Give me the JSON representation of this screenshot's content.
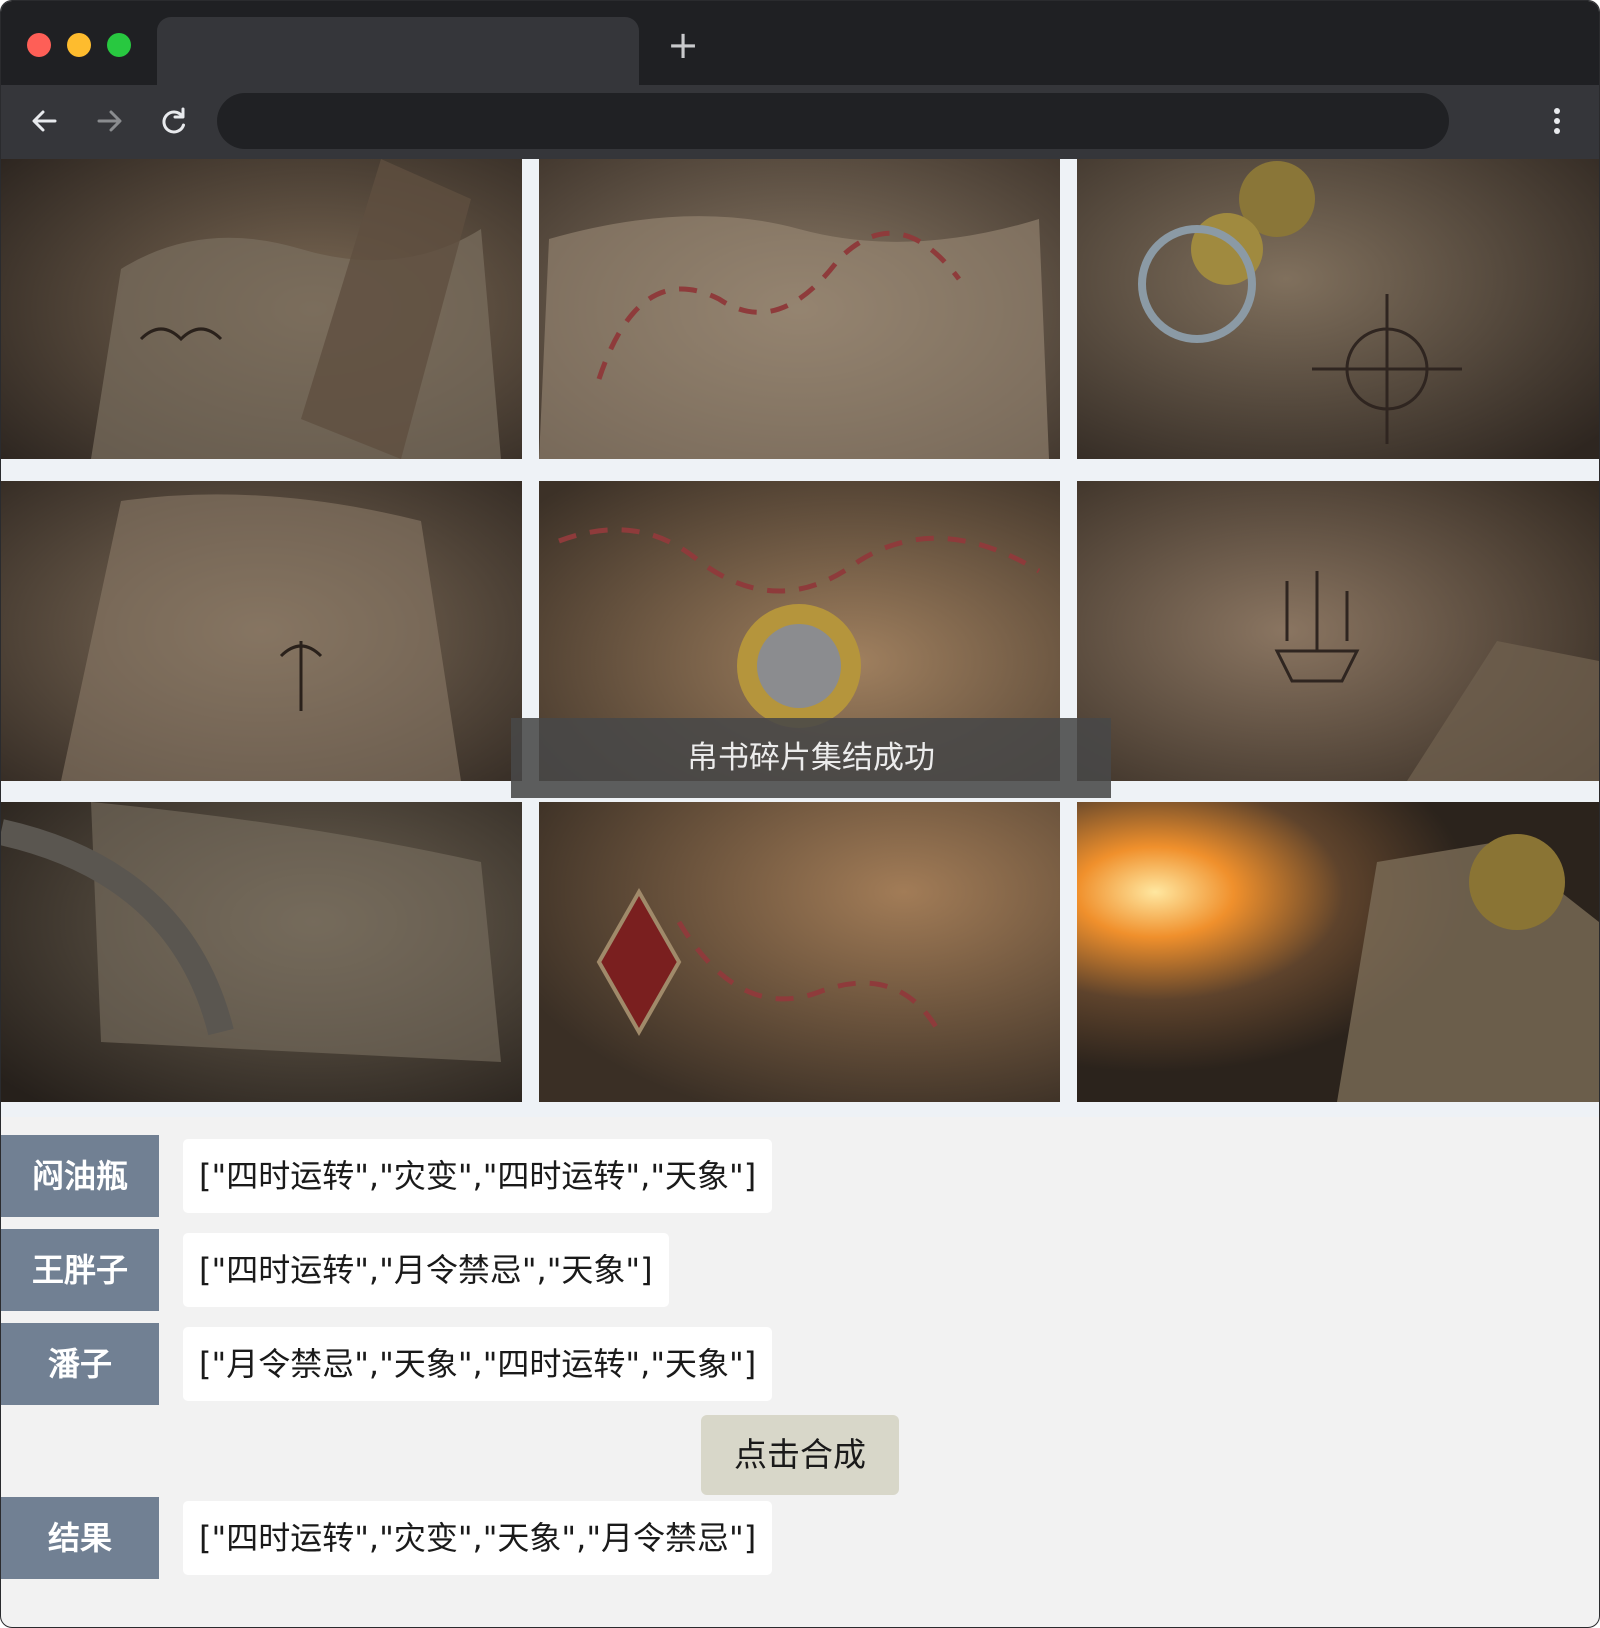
{
  "browser": {
    "new_tab_symbol": "+",
    "icons": [
      "back-arrow-icon",
      "forward-arrow-icon",
      "reload-icon",
      "more-vert-icon"
    ]
  },
  "puzzle": {
    "toast": "帛书碎片集结成功",
    "pieces": 9
  },
  "players": [
    {
      "name": "闷油瓶",
      "value": "[\"四时运转\",\"灾变\",\"四时运转\",\"天象\"]"
    },
    {
      "name": "王胖子",
      "value": "[\"四时运转\",\"月令禁忌\",\"天象\"]"
    },
    {
      "name": "潘子",
      "value": "[\"月令禁忌\",\"天象\",\"四时运转\",\"天象\"]"
    }
  ],
  "combine_button": "点击合成",
  "result": {
    "label": "结果",
    "value": "[\"四时运转\",\"灾变\",\"天象\",\"月令禁忌\"]"
  },
  "colors": {
    "label_bg": "#718093",
    "button_bg": "#d8d7c9",
    "page_bg": "#f2f2f2"
  }
}
